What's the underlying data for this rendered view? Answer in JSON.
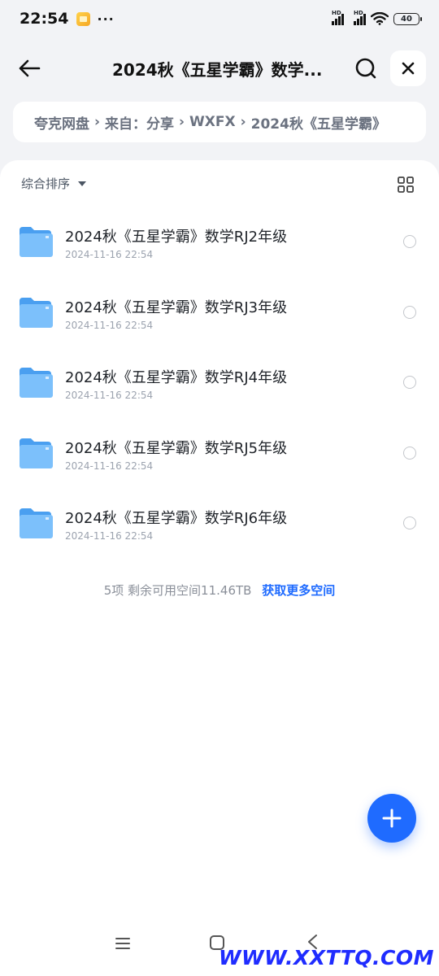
{
  "status_bar": {
    "time": "22:54",
    "more": "···",
    "battery": "40"
  },
  "header": {
    "title": "2024秋《五星学霸》数学..."
  },
  "breadcrumb": {
    "items": [
      "夸克网盘",
      "来自：分享",
      "WXFX",
      "2024秋《五星学霸》"
    ]
  },
  "toolbar": {
    "sort_label": "综合排序"
  },
  "files": [
    {
      "name": "2024秋《五星学霸》数学RJ2年级",
      "date": "2024-11-16 22:54"
    },
    {
      "name": "2024秋《五星学霸》数学RJ3年级",
      "date": "2024-11-16 22:54"
    },
    {
      "name": "2024秋《五星学霸》数学RJ4年级",
      "date": "2024-11-16 22:54"
    },
    {
      "name": "2024秋《五星学霸》数学RJ5年级",
      "date": "2024-11-16 22:54"
    },
    {
      "name": "2024秋《五星学霸》数学RJ6年级",
      "date": "2024-11-16 22:54"
    }
  ],
  "summary": {
    "text": "5项 剩余可用空间11.46TB",
    "link": "获取更多空间"
  },
  "watermark": "WWW.XXTTQ.COM",
  "colors": {
    "accent": "#1f6bff",
    "folder": "#5aa9f5",
    "background": "#f2f3f6"
  }
}
